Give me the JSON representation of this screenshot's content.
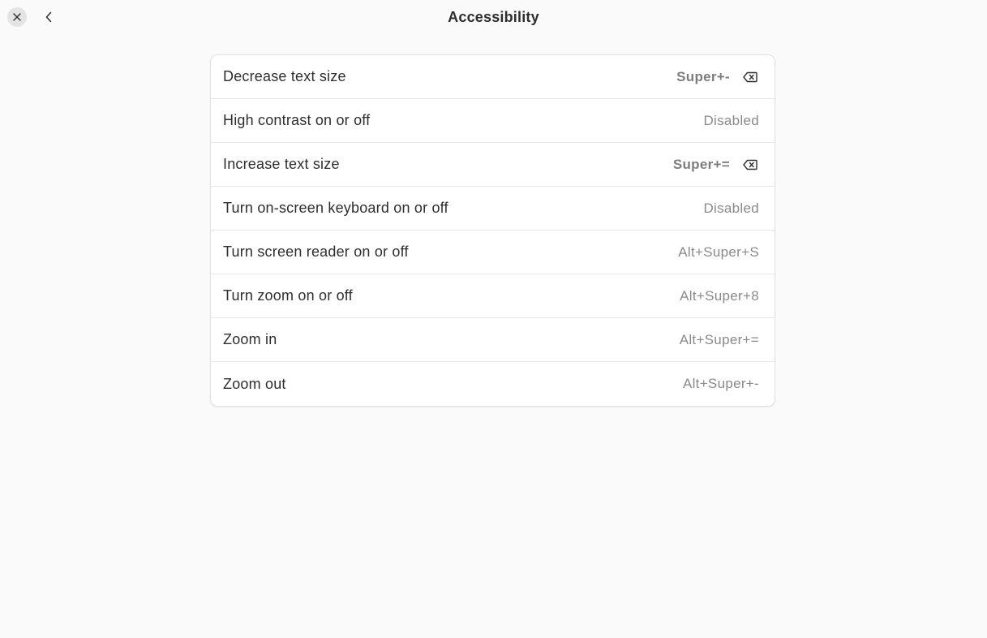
{
  "window": {
    "title": "Accessibility"
  },
  "header": {
    "close_icon": "close-icon",
    "back_icon": "chevron-left-icon"
  },
  "shortcuts": [
    {
      "label": "Decrease text size",
      "accel": "Super+-",
      "custom": true
    },
    {
      "label": "High contrast on or off",
      "accel": "Disabled",
      "custom": false
    },
    {
      "label": "Increase text size",
      "accel": "Super+=",
      "custom": true
    },
    {
      "label": "Turn on-screen keyboard on or off",
      "accel": "Disabled",
      "custom": false
    },
    {
      "label": "Turn screen reader on or off",
      "accel": "Alt+Super+S",
      "custom": false
    },
    {
      "label": "Turn zoom on or off",
      "accel": "Alt+Super+8",
      "custom": false
    },
    {
      "label": "Zoom in",
      "accel": "Alt+Super+=",
      "custom": false
    },
    {
      "label": "Zoom out",
      "accel": "Alt+Super+-",
      "custom": false
    }
  ],
  "colors": {
    "background": "#fafafa",
    "card": "#ffffff",
    "text": "#2e2e2e",
    "muted": "#8a8a8a"
  }
}
